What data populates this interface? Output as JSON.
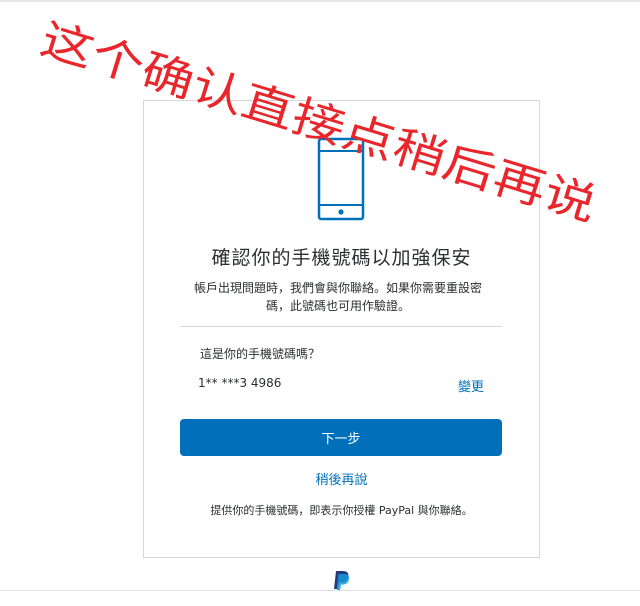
{
  "overlay": {
    "annotation": "这个确认直接点稍后再说",
    "color": "#e8262b"
  },
  "icons": {
    "phone": "phone-icon",
    "logo": "paypal-logo-icon"
  },
  "content": {
    "title": "確認你的手機號碼以加強保安",
    "subtext_line1": "帳戶出現問題時，我們會與你聯絡。如果你需要重設密",
    "subtext_line2": "碼，此號碼也可用作驗證。",
    "question": "這是你的手機號碼嗎？",
    "phone_number": "1** ***3 4986",
    "change_label": "變更",
    "next_label": "下一步",
    "later_label": "稍後再說",
    "consent": "提供你的手機號碼，即表示你授權 PayPal 與你聯絡。"
  },
  "colors": {
    "accent": "#0070ba",
    "text": "#2c2e2f"
  }
}
